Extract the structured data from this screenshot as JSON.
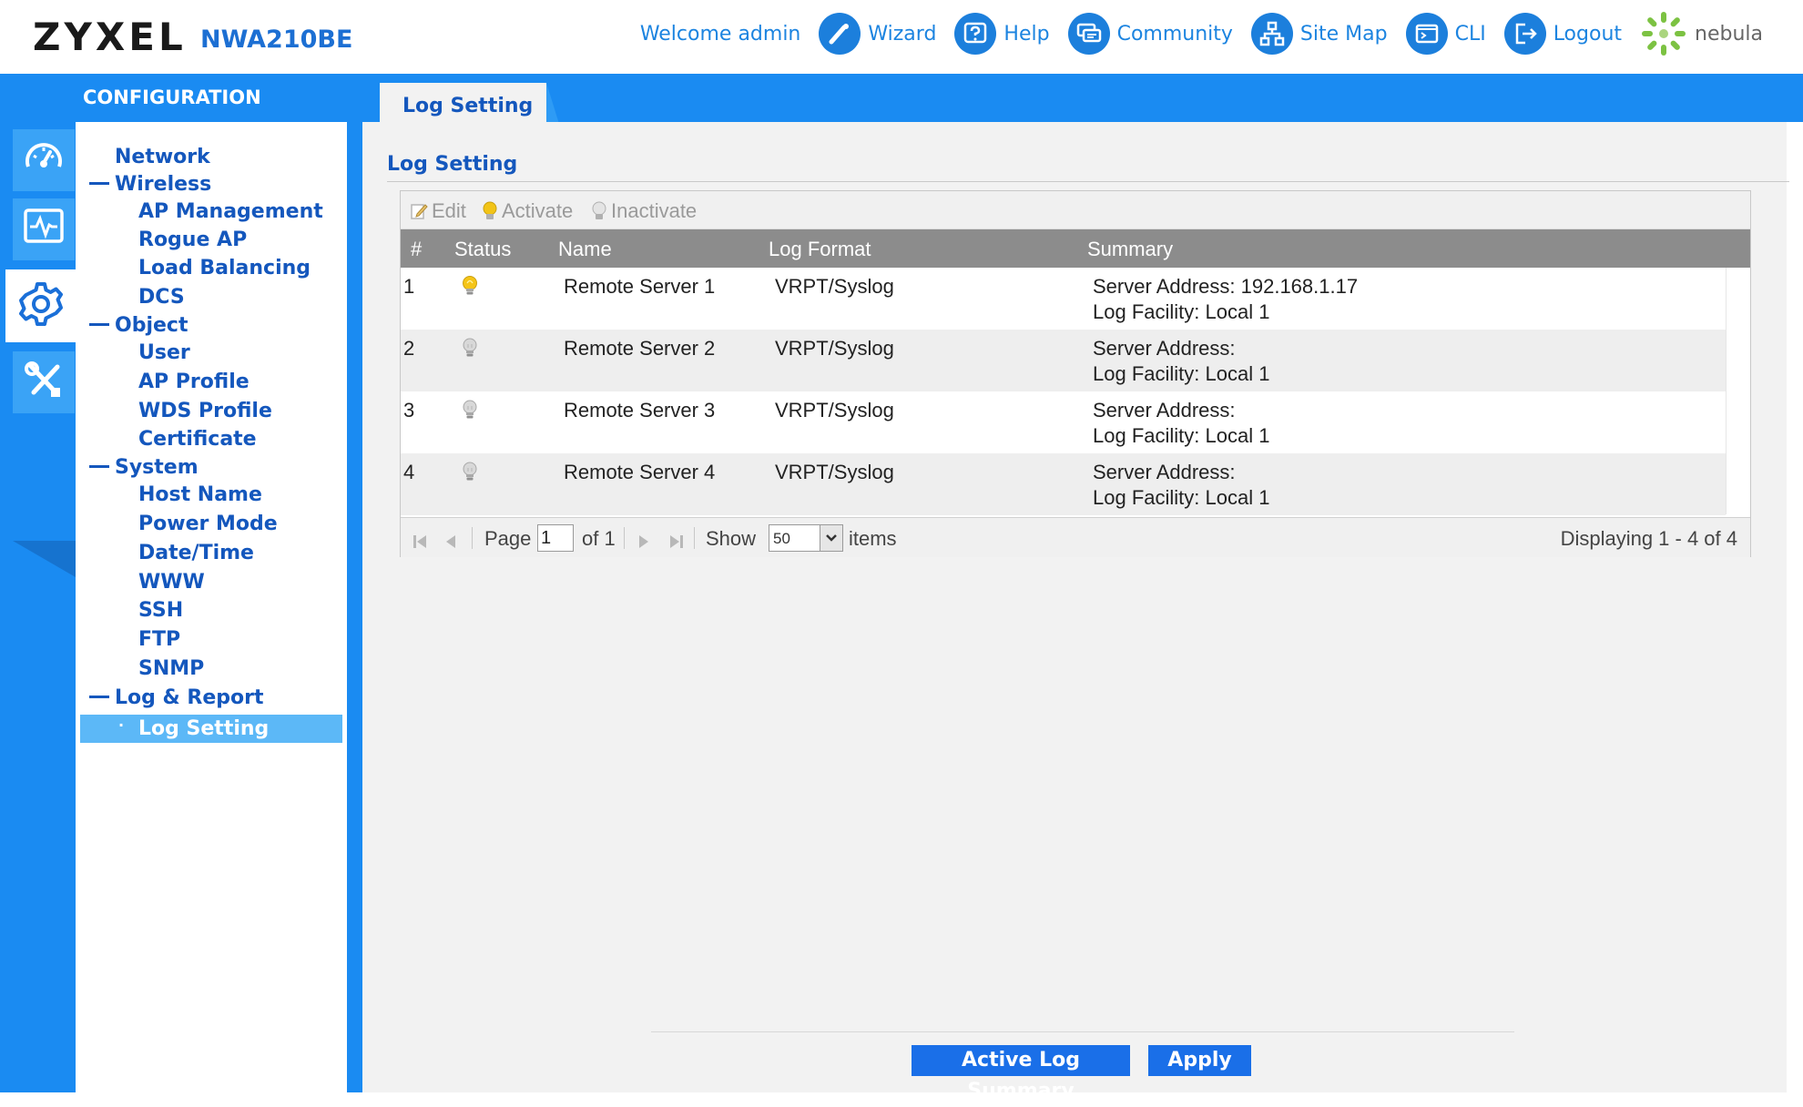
{
  "header": {
    "brand": "ZYXEL",
    "model": "NWA210BE",
    "welcome": "Welcome admin",
    "links": [
      {
        "label": "Wizard",
        "icon": "wizard-icon"
      },
      {
        "label": "Help",
        "icon": "help-icon"
      },
      {
        "label": "Community",
        "icon": "community-icon"
      },
      {
        "label": "Site Map",
        "icon": "sitemap-icon"
      },
      {
        "label": "CLI",
        "icon": "cli-icon"
      },
      {
        "label": "Logout",
        "icon": "logout-icon"
      }
    ],
    "nebula": "nebula"
  },
  "config_title": "CONFIGURATION",
  "tab": {
    "label": "Log Setting"
  },
  "rail": [
    "dashboard-icon",
    "monitor-icon",
    "configuration-icon",
    "maintenance-icon"
  ],
  "sidebar": {
    "groups": [
      {
        "label": "Network",
        "expanded": false,
        "items": []
      },
      {
        "label": "Wireless",
        "expanded": true,
        "items": [
          "AP Management",
          "Rogue AP",
          "Load Balancing",
          "DCS"
        ]
      },
      {
        "label": "Object",
        "expanded": true,
        "items": [
          "User",
          "AP Profile",
          "WDS Profile",
          "Certificate"
        ]
      },
      {
        "label": "System",
        "expanded": true,
        "items": [
          "Host Name",
          "Power Mode",
          "Date/Time",
          "WWW",
          "SSH",
          "FTP",
          "SNMP"
        ]
      },
      {
        "label": "Log & Report",
        "expanded": true,
        "items": [
          "Log Setting"
        ]
      }
    ],
    "selected": "Log Setting"
  },
  "main": {
    "section_title": "Log Setting",
    "toolbar": {
      "edit": "Edit",
      "activate": "Activate",
      "inactivate": "Inactivate"
    },
    "columns": [
      "#",
      "Status",
      "Name",
      "Log Format",
      "Summary"
    ],
    "rows": [
      {
        "num": "1",
        "active": true,
        "name": "Remote Server 1",
        "format": "VRPT/Syslog",
        "summary_1": "Server Address: 192.168.1.17",
        "summary_2": "Log Facility: Local 1"
      },
      {
        "num": "2",
        "active": false,
        "name": "Remote Server 2",
        "format": "VRPT/Syslog",
        "summary_1": "Server Address:",
        "summary_2": "Log Facility: Local 1"
      },
      {
        "num": "3",
        "active": false,
        "name": "Remote Server 3",
        "format": "VRPT/Syslog",
        "summary_1": "Server Address:",
        "summary_2": "Log Facility: Local 1"
      },
      {
        "num": "4",
        "active": false,
        "name": "Remote Server 4",
        "format": "VRPT/Syslog",
        "summary_1": "Server Address:",
        "summary_2": "Log Facility: Local 1"
      }
    ],
    "pager": {
      "page_label": "Page",
      "page": "1",
      "of_label": "of 1",
      "show_label": "Show",
      "show_value": "50",
      "items_label": "items",
      "display": "Displaying 1 - 4 of 4"
    }
  },
  "buttons": {
    "active_log_summary": "Active Log Summary",
    "apply": "Apply"
  },
  "colors": {
    "accent": "#1a8bf2",
    "nav_text": "#1457bd",
    "header_link": "#1c84e0",
    "button": "#1a6fe8",
    "bulb_on": "#f2c417",
    "bulb_off": "#b0b0b0",
    "selected_item": "#5cb8f7"
  }
}
